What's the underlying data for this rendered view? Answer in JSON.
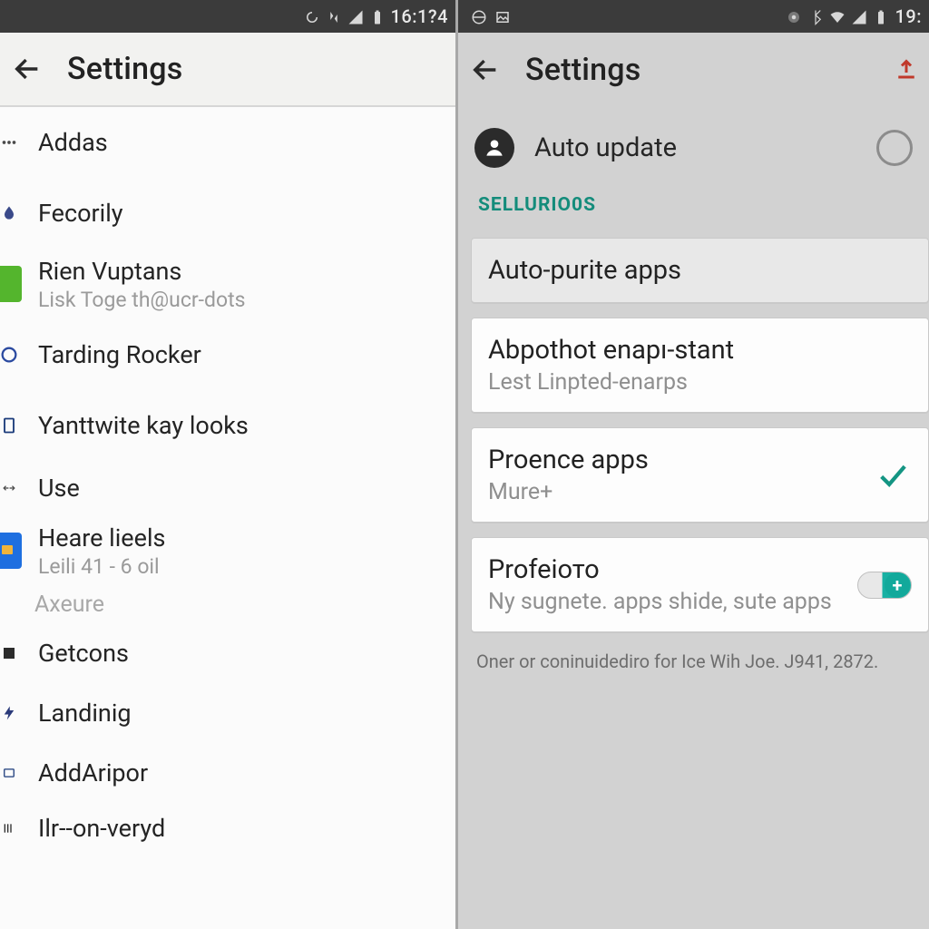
{
  "left": {
    "status_time": "16:1?4",
    "title": "Settings",
    "items": [
      {
        "title": "Addas",
        "sub": "",
        "icon": "dots-icon"
      },
      {
        "title": "Fecorily",
        "sub": "",
        "icon": "droplet-icon"
      },
      {
        "title": "Rien Vuptans",
        "sub": "Lisk Toge th@ucr-dots",
        "icon": "green-tile"
      },
      {
        "title": "Tarding Rocker",
        "sub": "",
        "icon": "circle-icon"
      },
      {
        "title": "Yanttwite kay looks",
        "sub": "",
        "icon": "device-icon"
      },
      {
        "title": "Use",
        "sub": "",
        "icon": "link-icon"
      },
      {
        "title": "Heare lieels",
        "sub": "Leili 41 - 6 oil",
        "icon": "blue-tile"
      }
    ],
    "section_label": "Axeure",
    "items2": [
      {
        "title": "Getcons",
        "icon": "square-icon"
      },
      {
        "title": "Landinig",
        "icon": "bolt-icon"
      },
      {
        "title": "AddAripor",
        "icon": "rect-icon"
      },
      {
        "title": "Ilr--on-veryd",
        "icon": "bars-icon"
      }
    ]
  },
  "right": {
    "status_time": "19:",
    "title": "Settings",
    "auto_update_label": "Auto update",
    "section_header": "SELLURIO0S",
    "cards": [
      {
        "title": "Auto-purite apps",
        "sub": "",
        "trailing": "none",
        "shaded": true
      },
      {
        "title": "Abpothot enapı-stant",
        "sub": "Lest Linpted-enarps",
        "trailing": "none",
        "shaded": false
      },
      {
        "title": "Proence apps",
        "sub": "Mure+",
        "trailing": "check",
        "shaded": false
      },
      {
        "title": "Profeiото",
        "sub": "Ny sugnete. apps shide, sute apps",
        "trailing": "toggle",
        "shaded": false
      }
    ],
    "footnote": "Oner or coninuidediro for Ice  Wih Joe.  J941, 2872."
  }
}
